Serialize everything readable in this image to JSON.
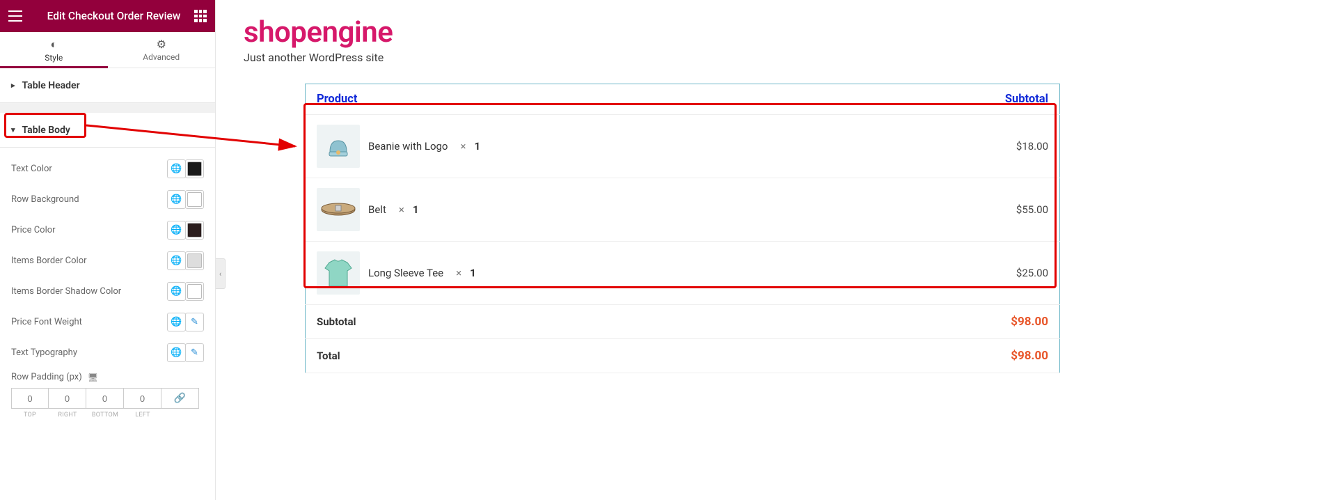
{
  "sidebar": {
    "title": "Edit Checkout Order Review",
    "tabs": {
      "style": "Style",
      "advanced": "Advanced"
    },
    "sections": {
      "table_header": "Table Header",
      "table_body": "Table Body"
    },
    "controls": {
      "text_color": {
        "label": "Text Color",
        "value": "#1a1a1a"
      },
      "row_background": {
        "label": "Row Background",
        "value": "#ffffff"
      },
      "price_color": {
        "label": "Price Color",
        "value": "#2b1d1d"
      },
      "items_border_color": {
        "label": "Items Border Color",
        "value": "#dddddd"
      },
      "items_border_shadow_color": {
        "label": "Items Border Shadow Color",
        "value": "#ffffff"
      },
      "price_font_weight": {
        "label": "Price Font Weight"
      },
      "text_typography": {
        "label": "Text Typography"
      },
      "row_padding": {
        "label": "Row Padding (px)",
        "top": "0",
        "right": "0",
        "bottom": "0",
        "left": "0",
        "lbl_top": "TOP",
        "lbl_right": "RIGHT",
        "lbl_bottom": "BOTTOM",
        "lbl_left": "LEFT"
      }
    }
  },
  "preview": {
    "brand": "shopengine",
    "tagline": "Just another WordPress site",
    "table": {
      "head_product": "Product",
      "head_subtotal": "Subtotal",
      "items": [
        {
          "name": "Beanie with Logo",
          "qty": "1",
          "price": "$18.00",
          "icon": "beanie"
        },
        {
          "name": "Belt",
          "qty": "1",
          "price": "$55.00",
          "icon": "belt"
        },
        {
          "name": "Long Sleeve Tee",
          "qty": "1",
          "price": "$25.00",
          "icon": "tee"
        }
      ],
      "subtotal_label": "Subtotal",
      "subtotal_value": "$98.00",
      "total_label": "Total",
      "total_value": "$98.00"
    }
  }
}
